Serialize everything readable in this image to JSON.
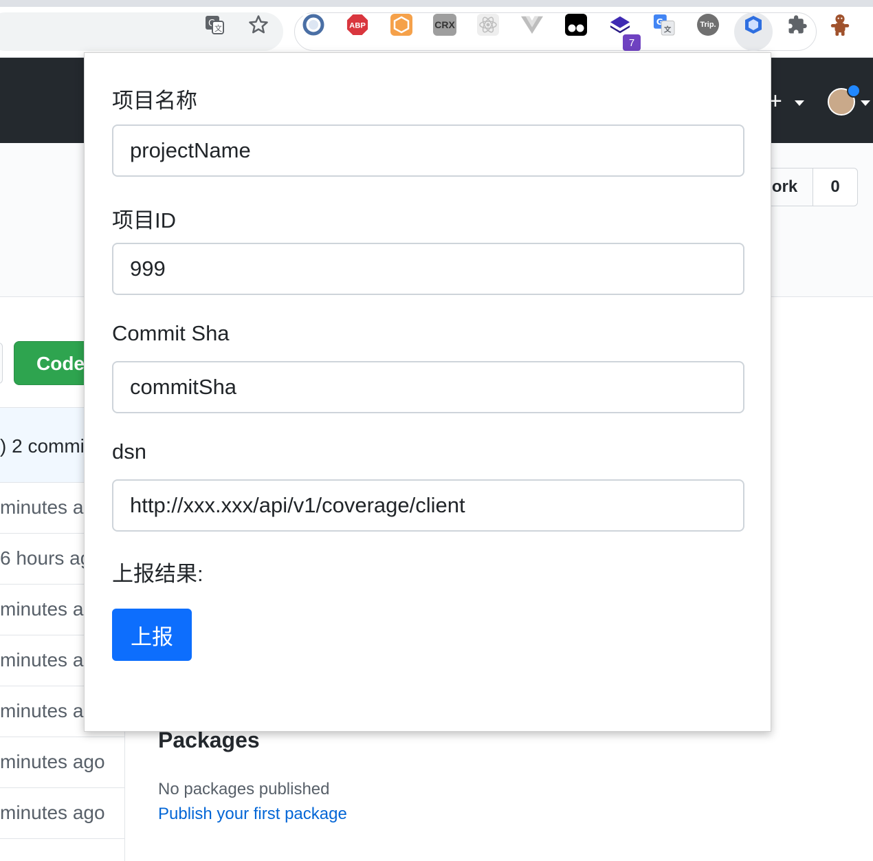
{
  "browser": {
    "extensions": [
      {
        "name": "edge-ring-icon",
        "label": "",
        "color": "#4a6fa5"
      },
      {
        "name": "adblock-plus-icon",
        "label": "ABP",
        "color": "#d9363e"
      },
      {
        "name": "hex-ext-icon",
        "label": "",
        "color": "#f5a14a"
      },
      {
        "name": "crx-icon",
        "label": "CRX",
        "color": "#9e9e9e"
      },
      {
        "name": "react-devtools-icon",
        "label": "",
        "color": "#e0e0e0"
      },
      {
        "name": "vue-devtools-icon",
        "label": "",
        "color": "#c0c0c0"
      },
      {
        "name": "tampermonkey-icon",
        "label": "",
        "color": "#000000"
      },
      {
        "name": "stack-ext-icon",
        "label": "",
        "color": "#3f2ab3"
      },
      {
        "name": "google-translate-icon",
        "label": "",
        "color": "#4285f4"
      },
      {
        "name": "trip-icon",
        "label": "Trip.",
        "color": "#707070"
      },
      {
        "name": "coverage-ext-icon",
        "label": "",
        "color": "#2f6fe0"
      },
      {
        "name": "puzzle-icon",
        "label": "",
        "color": "#5f6368"
      }
    ],
    "badge_count": "7"
  },
  "github": {
    "fork_label": "ork",
    "fork_count": "0",
    "code_button": "Code",
    "commits_text": ") 2 commi",
    "time_rows": [
      "minutes ag",
      "6 hours ag",
      "minutes ag",
      "minutes ag",
      "minutes ag",
      "minutes ago",
      "minutes ago"
    ],
    "packages_title": "Packages",
    "packages_none": "No packages published",
    "packages_link": "Publish your first package"
  },
  "popup": {
    "project_name_label": "项目名称",
    "project_name_value": "projectName",
    "project_id_label": "项目ID",
    "project_id_value": "999",
    "commit_sha_label": "Commit Sha",
    "commit_sha_value": "commitSha",
    "dsn_label": "dsn",
    "dsn_value": "http://xxx.xxx/api/v1/coverage/client",
    "result_label": "上报结果:",
    "submit_label": "上报"
  }
}
